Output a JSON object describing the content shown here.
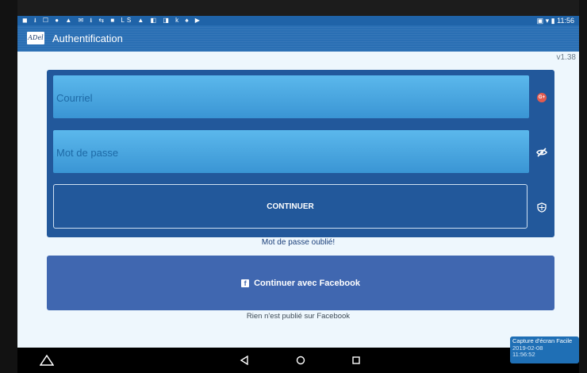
{
  "status_bar": {
    "icons": "◼ ⭳ ☐ ● ▲ ✉ ⭳ ⇆ ■ LS ▲ ◧ ◨ k ♠ ▶",
    "time": "▣ ▾ ▮ 11:56"
  },
  "app_bar": {
    "logo_text": "ADel",
    "title": "Authentification"
  },
  "content": {
    "version": "v1.38"
  },
  "login": {
    "email_placeholder": "Courriel",
    "password_placeholder": "Mot de passe",
    "continue_label": "CONTINUER",
    "forgot_password": "Mot de passe oublié!"
  },
  "facebook": {
    "icon_glyph": "f",
    "button_label": "Continuer avec Facebook",
    "note": "Rien n'est publié sur Facebook"
  },
  "toast": {
    "title": "Capture d'écran Facile",
    "date": "2019-02-08",
    "time": "11:56:52"
  },
  "colors": {
    "app_bar": "#2a6fb4",
    "card": "#22589b",
    "field": "#4aa8e2",
    "facebook": "#4067b0",
    "background": "#eef7fd"
  }
}
